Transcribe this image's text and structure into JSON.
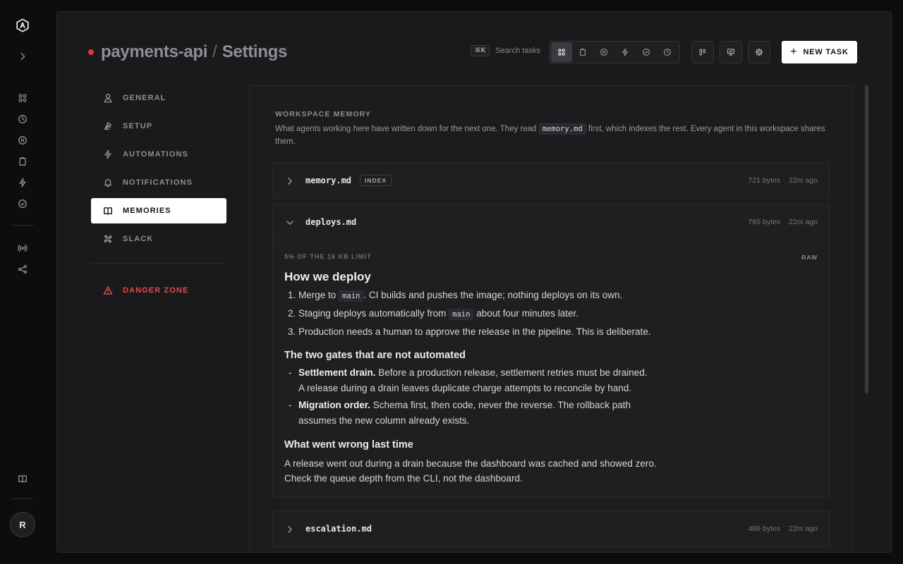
{
  "header": {
    "project": "payments-api",
    "separator": "/",
    "page": "Settings",
    "search_shortcut": "⌘K",
    "search_label": "Search tasks",
    "new_task_label": "NEW TASK"
  },
  "rail": {
    "avatar_initial": "R"
  },
  "settings_nav": {
    "items": [
      {
        "label": "GENERAL",
        "icon": "user-icon"
      },
      {
        "label": "SETUP",
        "icon": "setup-icon"
      },
      {
        "label": "AUTOMATIONS",
        "icon": "bolt-icon"
      },
      {
        "label": "NOTIFICATIONS",
        "icon": "bell-icon"
      },
      {
        "label": "MEMORIES",
        "icon": "book-icon",
        "active": true
      },
      {
        "label": "SLACK",
        "icon": "slack-icon"
      }
    ],
    "danger": {
      "label": "DANGER ZONE",
      "icon": "warning-icon"
    }
  },
  "memory": {
    "heading": "WORKSPACE MEMORY",
    "desc_pre": "What agents working here have written down for the next one. They read",
    "desc_code": "memory.md",
    "desc_post": "first, which indexes the rest. Every agent in this workspace shares them.",
    "files": [
      {
        "name": "memory.md",
        "badge": "INDEX",
        "size": "721 bytes",
        "age": "22m ago",
        "expanded": false
      },
      {
        "name": "deploys.md",
        "size": "765 bytes",
        "age": "22m ago",
        "expanded": true
      },
      {
        "name": "escalation.md",
        "size": "486 bytes",
        "age": "22m ago",
        "expanded": false
      }
    ],
    "deploys": {
      "limit": "5% OF THE 16 KB LIMIT",
      "raw_label": "RAW",
      "h1": "How we deploy",
      "steps": {
        "s1_pre": "Merge to",
        "s1_code": "main",
        "s1_post": ". CI builds and pushes the image; nothing deploys on its own.",
        "s2_pre": "Staging deploys automatically from",
        "s2_code": "main",
        "s2_post": "about four minutes later.",
        "s3": "Production needs a human to approve the release in the pipeline. This is deliberate."
      },
      "h2_gates": "The two gates that are not automated",
      "gates": {
        "g1_bold": "Settlement drain.",
        "g1_line1": "Before a production release, settlement retries must be drained.",
        "g1_line2": "A release during a drain leaves duplicate charge attempts to reconcile by hand.",
        "g2_bold": "Migration order.",
        "g2_line1": "Schema first, then code, never the reverse. The rollback path",
        "g2_line2": "assumes the new column already exists."
      },
      "h2_wrong": "What went wrong last time",
      "wrong_line1": "A release went out during a drain because the dashboard was cached and showed zero.",
      "wrong_line2": "Check the queue depth from the CLI, not the dashboard."
    }
  }
}
